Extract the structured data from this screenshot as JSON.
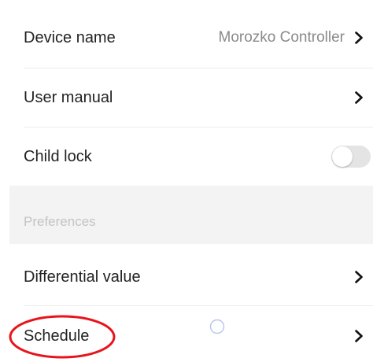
{
  "settings": {
    "rows": [
      {
        "label": "Device name",
        "value": "Morozko Controller",
        "chevron_icon": "chevron-right-icon"
      },
      {
        "label": "User manual",
        "chevron_icon": "chevron-right-icon"
      },
      {
        "label": "Child lock",
        "toggle_on": false
      },
      {
        "label": "Differential value",
        "chevron_icon": "chevron-right-icon"
      },
      {
        "label": "Schedule",
        "chevron_icon": "chevron-right-icon"
      }
    ],
    "section_header": "Preferences"
  },
  "colors": {
    "background": "#ffffff",
    "section_bg": "#f3f3f3",
    "text_primary": "#222222",
    "text_secondary": "#8a8a8a",
    "section_text": "#c4c4c4",
    "toggle_off": "#e4e4e4",
    "annotation_red": "#e8141b",
    "touch_indicator": "#b8c4f0"
  },
  "overlays": {
    "highlight": "red-ellipse-annotation",
    "touch": "touch-indicator-circle"
  }
}
